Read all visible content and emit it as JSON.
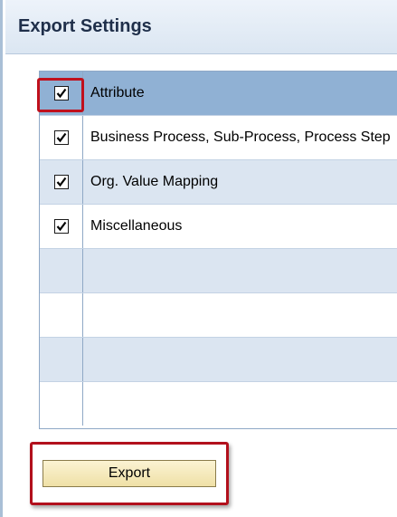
{
  "header": {
    "title": "Export Settings"
  },
  "table": {
    "rows": [
      {
        "label": "Attribute",
        "checked": true,
        "selected": true
      },
      {
        "label": "Business Process, Sub-Process, Process Step",
        "checked": true,
        "selected": false
      },
      {
        "label": "Org. Value Mapping",
        "checked": true,
        "selected": false
      },
      {
        "label": "Miscellaneous",
        "checked": true,
        "selected": false
      },
      {
        "label": "",
        "checked": false,
        "selected": false
      },
      {
        "label": "",
        "checked": false,
        "selected": false
      },
      {
        "label": "",
        "checked": false,
        "selected": false
      },
      {
        "label": "",
        "checked": false,
        "selected": false
      }
    ]
  },
  "actions": {
    "export_label": "Export"
  },
  "colors": {
    "highlight_red": "#c0101c",
    "selected_row": "#90b1d4",
    "alt_row": "#dbe5f1"
  }
}
